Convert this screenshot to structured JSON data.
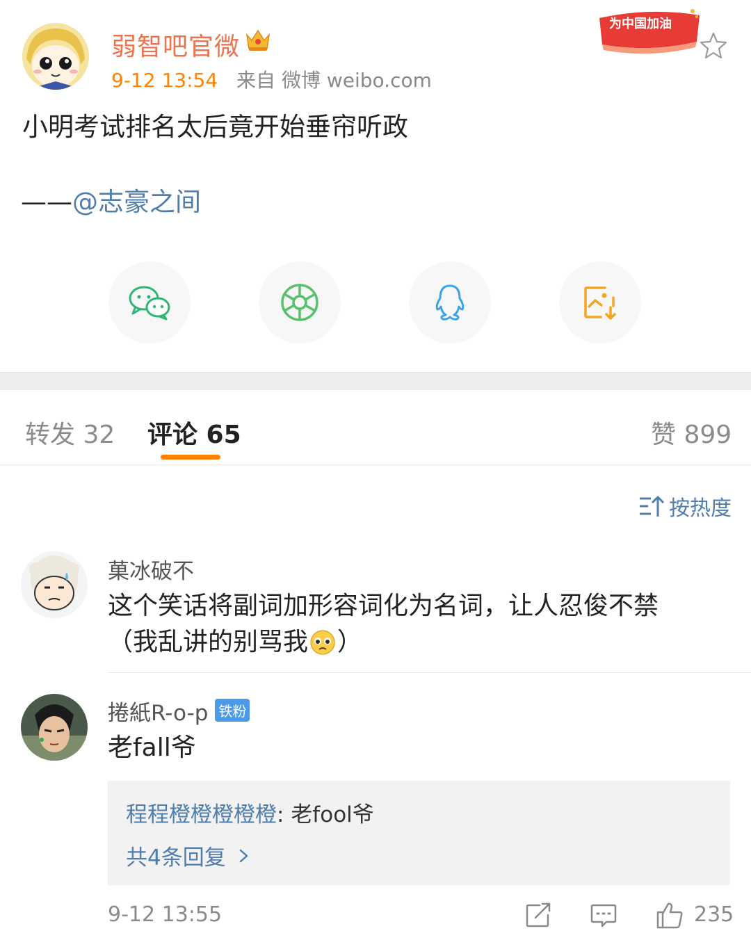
{
  "post": {
    "author": "弱智吧官微",
    "time": "9-12 13:54",
    "source": "来自 微博 weibo.com",
    "badge_text": "为中国加油",
    "text": "小明考试排名太后竟开始垂帘听政",
    "credit_prefix": "——",
    "credit_mention": "@志豪之间"
  },
  "share": [
    "wechat-icon",
    "moments-icon",
    "qq-icon",
    "save-image-icon"
  ],
  "tabs": {
    "repost": "转发 32",
    "comment": "评论 65",
    "like": "赞 899"
  },
  "sort_label": "按热度",
  "comments": [
    {
      "name": "菓冰破不",
      "text_line1": "这个笑话将副词加形容词化为名词，让人忍俊不禁",
      "text_line2": "（我乱讲的别骂我",
      "text_line2_end": "）"
    },
    {
      "name": "捲紙R-o-p",
      "badge": "铁粉",
      "text": "老fall爷",
      "reply": {
        "name": "程程橙橙橙橙橙",
        "sep": ": ",
        "text": "老fool爷",
        "more": "共4条回复"
      },
      "time": "9-12 13:55",
      "likes": "235"
    }
  ],
  "colors": {
    "accent": "#ff8200",
    "link": "#4f7dac",
    "author": "#eb7350"
  }
}
